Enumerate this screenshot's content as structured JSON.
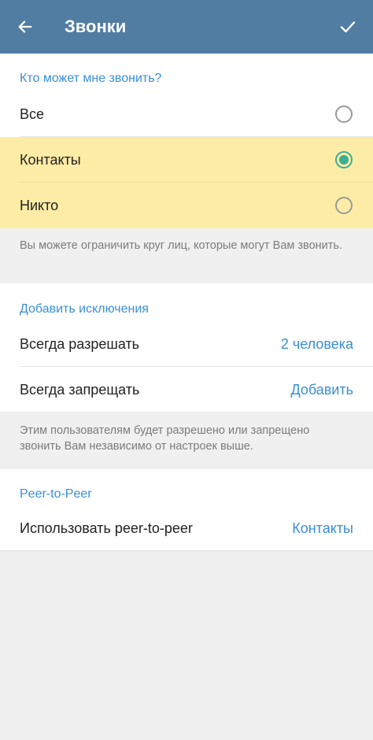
{
  "appbar": {
    "title": "Звонки",
    "back_icon": "arrow-left-icon",
    "done_icon": "check-icon",
    "color": "#527da3"
  },
  "who_can_call": {
    "header": "Кто может мне звонить?",
    "options": [
      {
        "label": "Все",
        "selected": false
      },
      {
        "label": "Контакты",
        "selected": true
      },
      {
        "label": "Никто",
        "selected": false
      }
    ],
    "hint": "Вы можете ограничить круг лиц, которые могут Вам звонить."
  },
  "exceptions": {
    "header": "Добавить исключения",
    "always_allow": {
      "label": "Всегда разрешать",
      "value": "2 человека"
    },
    "never_allow": {
      "label": "Всегда запрещать",
      "value": "Добавить"
    },
    "hint": "Этим пользователям будет разрешено или запрещено звонить Вам независимо от настроек выше."
  },
  "p2p": {
    "header": "Peer-to-Peer",
    "row": {
      "label": "Использовать peer-to-peer",
      "value": "Контакты"
    }
  },
  "colors": {
    "accent": "#3a8fd6",
    "radio_selected": "#3cae93",
    "highlight": "#fdeca6"
  }
}
